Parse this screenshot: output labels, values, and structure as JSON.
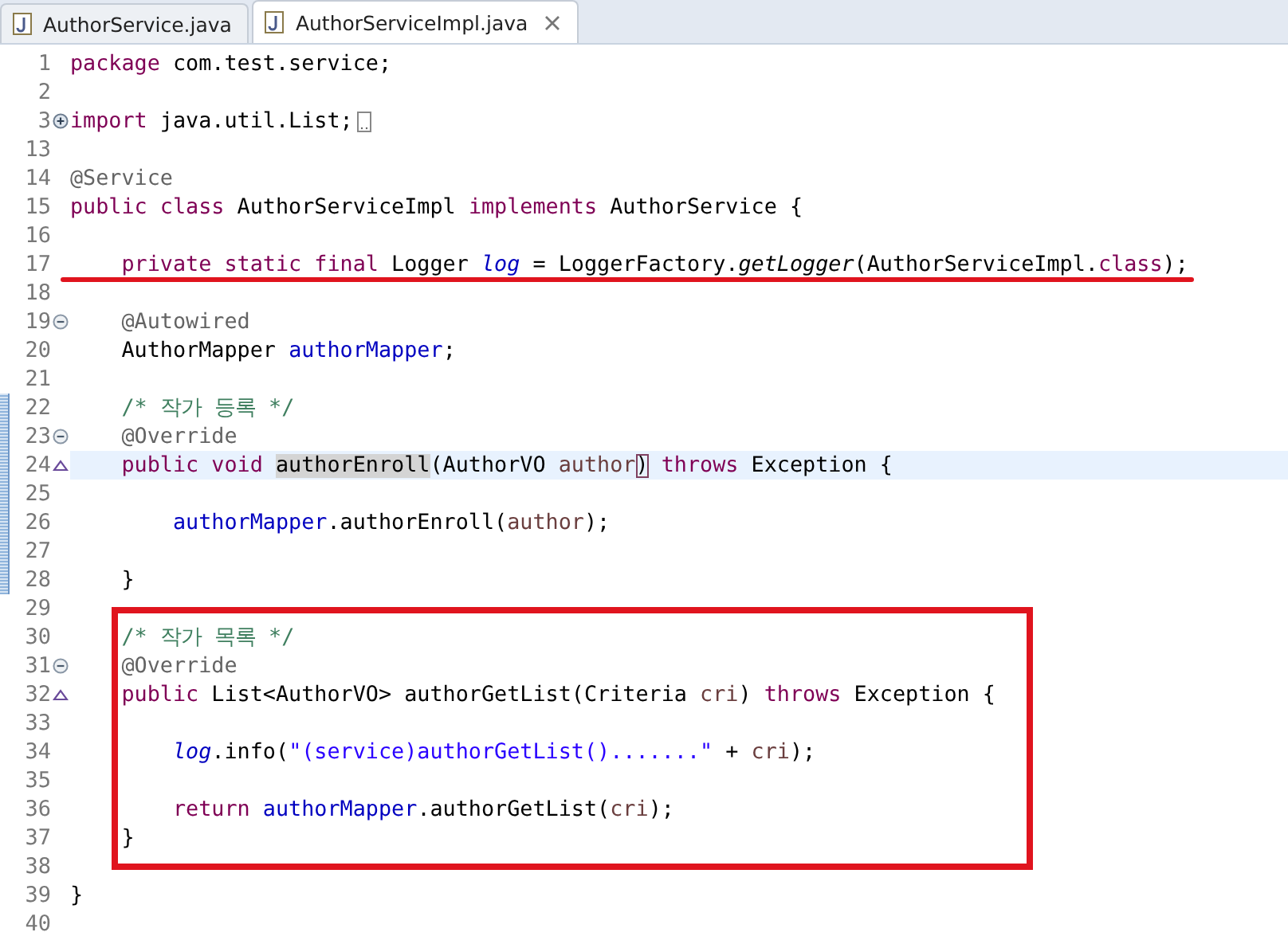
{
  "tabs": [
    {
      "label": "AuthorService.java",
      "selected": false,
      "closable": false
    },
    {
      "label": "AuthorServiceImpl.java",
      "selected": true,
      "closable": true
    }
  ],
  "sections": [
    {
      "boxed": false,
      "lines": [
        {
          "number": "1",
          "kind": "plain",
          "current": false,
          "changed": false,
          "underlined": false,
          "folded": false,
          "tokens": [
            {
              "kind": "keyword",
              "text": "package"
            },
            {
              "kind": "plain",
              "text": " com.test.service;"
            }
          ]
        },
        {
          "number": "2",
          "kind": "plain",
          "current": false,
          "changed": false,
          "underlined": false,
          "folded": false
        },
        {
          "number": "3",
          "kind": "fold-expand",
          "current": false,
          "changed": false,
          "underlined": false,
          "folded": true,
          "tokens": [
            {
              "kind": "keyword",
              "text": "import"
            },
            {
              "kind": "plain",
              "text": " java.util.List;"
            }
          ]
        },
        {
          "number": "13",
          "kind": "plain",
          "current": false,
          "changed": false,
          "underlined": false,
          "folded": false
        },
        {
          "number": "14",
          "kind": "plain",
          "current": false,
          "changed": false,
          "underlined": false,
          "folded": false,
          "tokens": [
            {
              "kind": "annotation",
              "text": "@Service"
            }
          ]
        },
        {
          "number": "15",
          "kind": "plain",
          "current": false,
          "changed": false,
          "underlined": false,
          "folded": false,
          "tokens": [
            {
              "kind": "keyword",
              "text": "public class"
            },
            {
              "kind": "plain",
              "text": " AuthorServiceImpl "
            },
            {
              "kind": "keyword",
              "text": "implements"
            },
            {
              "kind": "plain",
              "text": " AuthorService {"
            }
          ]
        },
        {
          "number": "16",
          "kind": "plain",
          "current": false,
          "changed": false,
          "underlined": false,
          "folded": false
        },
        {
          "number": "17",
          "kind": "plain",
          "current": false,
          "changed": false,
          "underlined": true,
          "folded": false,
          "tokens": [
            {
              "kind": "keyword",
              "text": "    private static final"
            },
            {
              "kind": "plain",
              "text": " Logger "
            },
            {
              "kind": "static-field",
              "text": "log"
            },
            {
              "kind": "plain",
              "text": " = LoggerFactory."
            },
            {
              "kind": "static-method",
              "text": "getLogger"
            },
            {
              "kind": "plain",
              "text": "(AuthorServiceImpl."
            },
            {
              "kind": "keyword",
              "text": "class"
            },
            {
              "kind": "plain",
              "text": ");"
            }
          ]
        },
        {
          "number": "18",
          "kind": "plain",
          "current": false,
          "changed": false,
          "underlined": false,
          "folded": false
        },
        {
          "number": "19",
          "kind": "fold-collapse",
          "current": false,
          "changed": false,
          "underlined": false,
          "folded": false,
          "tokens": [
            {
              "kind": "annotation",
              "text": "    @Autowired"
            }
          ]
        },
        {
          "number": "20",
          "kind": "plain",
          "current": false,
          "changed": false,
          "underlined": false,
          "folded": false,
          "tokens": [
            {
              "kind": "plain",
              "text": "    AuthorMapper "
            },
            {
              "kind": "field",
              "text": "authorMapper"
            },
            {
              "kind": "plain",
              "text": ";"
            }
          ]
        },
        {
          "number": "21",
          "kind": "plain",
          "current": false,
          "changed": false,
          "underlined": false,
          "folded": false
        },
        {
          "number": "22",
          "kind": "plain",
          "current": false,
          "changed": true,
          "underlined": false,
          "folded": false,
          "tokens": [
            {
              "kind": "comment",
              "text": "    /* 작가 등록 */"
            }
          ]
        },
        {
          "number": "23",
          "kind": "fold-collapse",
          "current": false,
          "changed": true,
          "underlined": false,
          "folded": false,
          "tokens": [
            {
              "kind": "annotation",
              "text": "    @Override"
            }
          ]
        },
        {
          "number": "24",
          "kind": "override",
          "current": true,
          "changed": true,
          "underlined": false,
          "folded": false,
          "tokens": [
            {
              "kind": "keyword",
              "text": "    public void"
            },
            {
              "kind": "occurrence",
              "text": " authorEnroll"
            },
            {
              "kind": "plain",
              "text": "(AuthorVO "
            },
            {
              "kind": "param",
              "text": "author"
            },
            {
              "kind": "bracket-match",
              "text": ")"
            },
            {
              "kind": "keyword",
              "text": " throws"
            },
            {
              "kind": "plain",
              "text": " Exception {"
            }
          ]
        },
        {
          "number": "25",
          "kind": "plain",
          "current": false,
          "changed": true,
          "underlined": false,
          "folded": false
        },
        {
          "number": "26",
          "kind": "plain",
          "current": false,
          "changed": true,
          "underlined": false,
          "folded": false,
          "tokens": [
            {
              "kind": "field",
              "text": "        authorMapper"
            },
            {
              "kind": "plain",
              "text": ".authorEnroll("
            },
            {
              "kind": "param",
              "text": "author"
            },
            {
              "kind": "plain",
              "text": ");"
            }
          ]
        },
        {
          "number": "27",
          "kind": "plain",
          "current": false,
          "changed": true,
          "underlined": false,
          "folded": false
        },
        {
          "number": "28",
          "kind": "plain",
          "current": false,
          "changed": true,
          "underlined": false,
          "folded": false,
          "tokens": [
            {
              "kind": "plain",
              "text": "    }"
            }
          ]
        },
        {
          "number": "29",
          "kind": "plain",
          "current": false,
          "changed": false,
          "underlined": false,
          "folded": false
        }
      ]
    },
    {
      "boxed": true,
      "lines": [
        {
          "number": "30",
          "kind": "plain",
          "current": false,
          "changed": false,
          "underlined": false,
          "folded": false,
          "tokens": [
            {
              "kind": "comment",
              "text": "    /* 작가 목록 */"
            }
          ]
        },
        {
          "number": "31",
          "kind": "fold-collapse",
          "current": false,
          "changed": false,
          "underlined": false,
          "folded": false,
          "tokens": [
            {
              "kind": "annotation",
              "text": "    @Override"
            }
          ]
        },
        {
          "number": "32",
          "kind": "override",
          "current": false,
          "changed": false,
          "underlined": false,
          "folded": false,
          "tokens": [
            {
              "kind": "keyword",
              "text": "    public"
            },
            {
              "kind": "plain",
              "text": " List<AuthorVO> authorGetList(Criteria "
            },
            {
              "kind": "param",
              "text": "cri"
            },
            {
              "kind": "plain",
              "text": ") "
            },
            {
              "kind": "keyword",
              "text": "throws"
            },
            {
              "kind": "plain",
              "text": " Exception {"
            }
          ]
        },
        {
          "number": "33",
          "kind": "plain",
          "current": false,
          "changed": false,
          "underlined": false,
          "folded": false
        },
        {
          "number": "34",
          "kind": "plain",
          "current": false,
          "changed": false,
          "underlined": false,
          "folded": false,
          "tokens": [
            {
              "kind": "static-field",
              "text": "        log"
            },
            {
              "kind": "plain",
              "text": ".info("
            },
            {
              "kind": "string",
              "text": "\"(service)authorGetList().......\""
            },
            {
              "kind": "plain",
              "text": " + "
            },
            {
              "kind": "param",
              "text": "cri"
            },
            {
              "kind": "plain",
              "text": ");"
            }
          ]
        },
        {
          "number": "35",
          "kind": "plain",
          "current": false,
          "changed": false,
          "underlined": false,
          "folded": false
        },
        {
          "number": "36",
          "kind": "plain",
          "current": false,
          "changed": false,
          "underlined": false,
          "folded": false,
          "tokens": [
            {
              "kind": "keyword",
              "text": "        return"
            },
            {
              "kind": "field",
              "text": " authorMapper"
            },
            {
              "kind": "plain",
              "text": ".authorGetList("
            },
            {
              "kind": "param",
              "text": "cri"
            },
            {
              "kind": "plain",
              "text": ");"
            }
          ]
        },
        {
          "number": "37",
          "kind": "plain",
          "current": false,
          "changed": false,
          "underlined": false,
          "folded": false,
          "tokens": [
            {
              "kind": "plain",
              "text": "    }"
            }
          ]
        }
      ]
    },
    {
      "boxed": false,
      "lines": [
        {
          "number": "38",
          "kind": "plain",
          "current": false,
          "changed": false,
          "underlined": false,
          "folded": false
        },
        {
          "number": "39",
          "kind": "plain",
          "current": false,
          "changed": false,
          "underlined": false,
          "folded": false,
          "tokens": [
            {
              "kind": "plain",
              "text": "}"
            }
          ]
        },
        {
          "number": "40",
          "kind": "plain",
          "current": false,
          "changed": false,
          "underlined": false,
          "folded": false
        }
      ]
    }
  ]
}
